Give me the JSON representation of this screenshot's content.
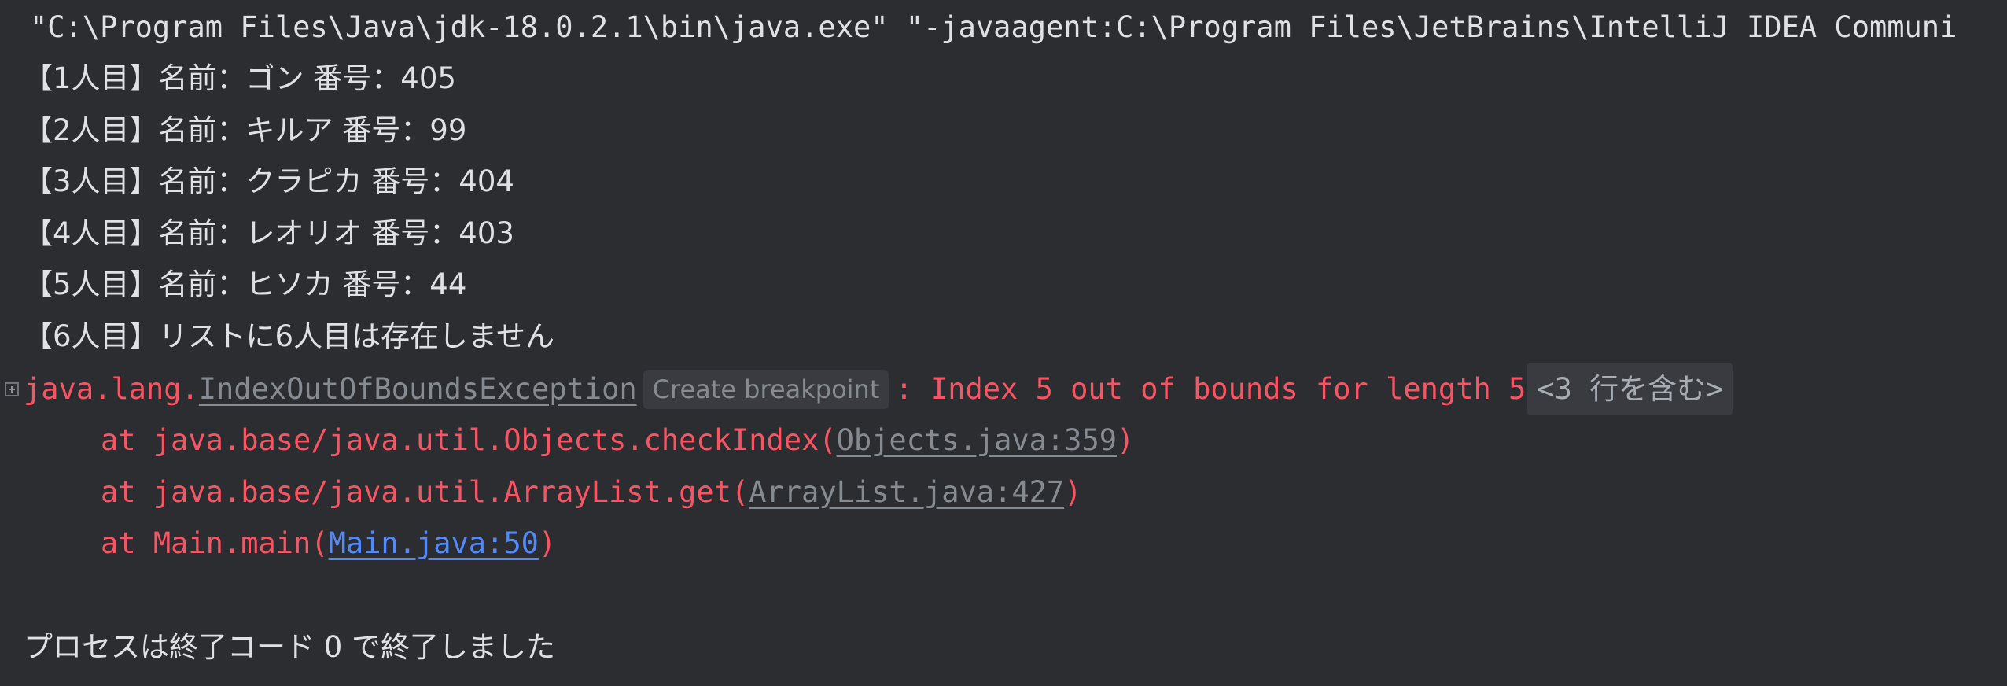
{
  "console": {
    "command": "\"C:\\Program Files\\Java\\jdk-18.0.2.1\\bin\\java.exe\" \"-javaagent:C:\\Program Files\\JetBrains\\IntelliJ IDEA Communi",
    "output_lines": [
      "【1人目】名前：ゴン 番号：405",
      "【2人目】名前：キルア 番号：99",
      "【3人目】名前：クラピカ 番号：404",
      "【4人目】名前：レオリオ 番号：403",
      "【5人目】名前：ヒソカ 番号：44",
      "【6人目】リストに6人目は存在しません"
    ],
    "exception": {
      "package": "java.lang.",
      "class_name": "IndexOutOfBoundsException",
      "breakpoint_label": "Create breakpoint",
      "message": ": Index 5 out of bounds for length 5",
      "fold_label": "<3 行を含む>"
    },
    "stack": [
      {
        "prefix": "at java.base/java.util.Objects.checkIndex(",
        "link": "Objects.java:359",
        "suffix": ")"
      },
      {
        "prefix": "at java.base/java.util.ArrayList.get(",
        "link": "ArrayList.java:427",
        "suffix": ")"
      },
      {
        "prefix": "at Main.main(",
        "link": "Main.java:50",
        "suffix": ")"
      }
    ],
    "exit_message": "プロセスは終了コード 0 で終了しました"
  },
  "colors": {
    "background": "#2b2d30",
    "text": "#dfe1e5",
    "error": "#f75464",
    "link_gray": "#868a91",
    "link_blue": "#548af7"
  }
}
